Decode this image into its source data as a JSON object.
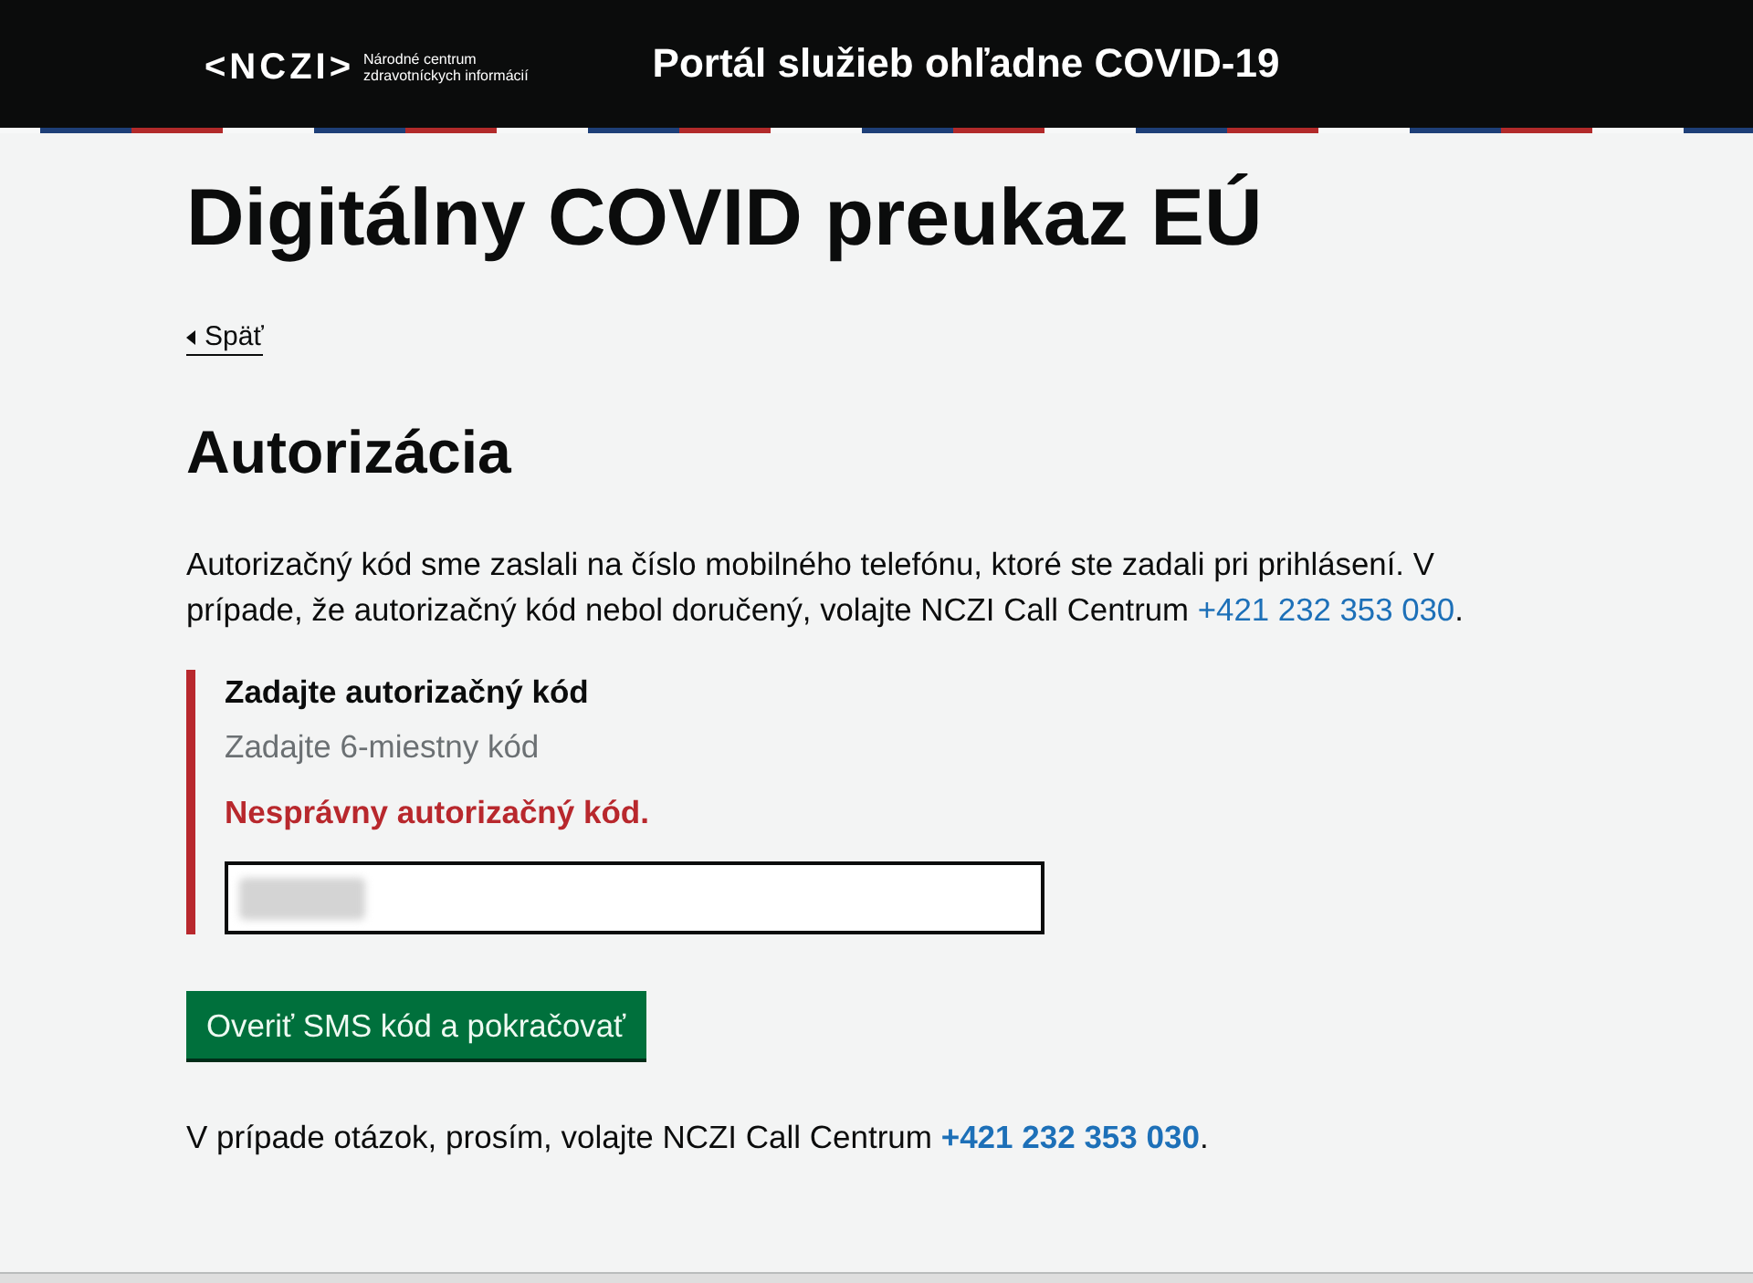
{
  "header": {
    "logo": {
      "mark": "<NCZI>",
      "subtitle_lines": [
        "Národné centrum",
        "zdravotníckych informácií"
      ]
    },
    "title": "Portál služieb ohľadne COVID-19"
  },
  "page": {
    "heading": "Digitálny COVID preukaz EÚ",
    "back_link": "Späť"
  },
  "section": {
    "heading": "Autorizácia",
    "intro": {
      "text": "Autorizačný kód sme zaslali na číslo mobilného telefónu, ktoré ste zadali pri prihlásení. V prípade, že autorizačný kód nebol doručený, volajte NCZI Call Centrum",
      "phone": "+421 232 353 030",
      "after": "."
    }
  },
  "form": {
    "label": "Zadajte autorizačný kód",
    "hint": "Zadajte 6-miestny kód",
    "invalid": true,
    "error": "Nesprávny autorizačný kód.",
    "value_redacted": true,
    "submit_button": "Overiť SMS kód a pokračovať"
  },
  "help": {
    "text": "V prípade otázok, prosím, volajte NCZI Call Centrum",
    "phone": "+421 232 353 030",
    "after": "."
  }
}
